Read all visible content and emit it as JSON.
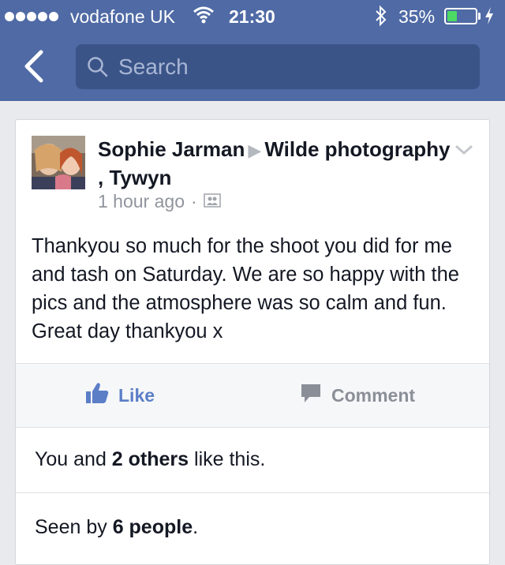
{
  "status_bar": {
    "carrier": "vodafone UK",
    "time": "21:30",
    "battery_percent": "35%",
    "battery_level": 0.35
  },
  "nav": {
    "search_placeholder": "Search"
  },
  "post": {
    "author": "Sophie Jarman",
    "target": "Wilde photography , Tywyn",
    "timestamp": "1 hour ago",
    "separator": "·",
    "body": "Thankyou so much for the shoot you did for me and tash on Saturday. We are so happy with the pics and the atmosphere was so calm and fun. Great day thankyou x",
    "like_label": "Like",
    "comment_label": "Comment",
    "likes": {
      "prefix": "You and ",
      "count_text": "2 others",
      "suffix": " like this."
    },
    "seen": {
      "prefix": "Seen by ",
      "count_text": "6 people",
      "suffix": "."
    }
  },
  "colors": {
    "header": "#4f6aa5",
    "search_bg": "#3b5488",
    "like_blue": "#5b7ec7",
    "battery_green": "#4cd964"
  }
}
